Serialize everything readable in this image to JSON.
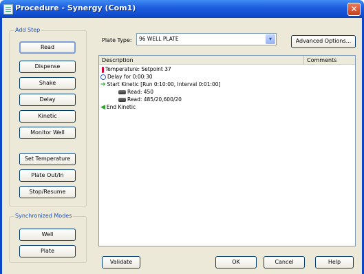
{
  "window": {
    "title": "Procedure - Synergy (Com1)",
    "close_glyph": "✕"
  },
  "add_step": {
    "label": "Add Step",
    "buttons": [
      "Read",
      "Dispense",
      "Shake",
      "Delay",
      "Kinetic",
      "Monitor Well",
      "Set Temperature",
      "Plate Out/In",
      "Stop/Resume"
    ]
  },
  "sync_modes": {
    "label": "Synchronized Modes",
    "buttons": [
      "Well",
      "Plate"
    ]
  },
  "plate_type": {
    "label": "Plate Type:",
    "value": "96 WELL PLATE",
    "arrow": "▾"
  },
  "advanced_options": "Advanced Options...",
  "list": {
    "headers": {
      "description": "Description",
      "comments": "Comments"
    },
    "rows": [
      "Temperature:  Setpoint 37",
      "Delay for 0:00:30",
      "Start Kinetic [Run 0:10:00, Interval 0:01:00]",
      "Read:  450",
      "Read:  485/20,600/20",
      "End Kinetic"
    ]
  },
  "footer": {
    "validate": "Validate",
    "ok": "OK",
    "cancel": "Cancel",
    "help": "Help"
  }
}
